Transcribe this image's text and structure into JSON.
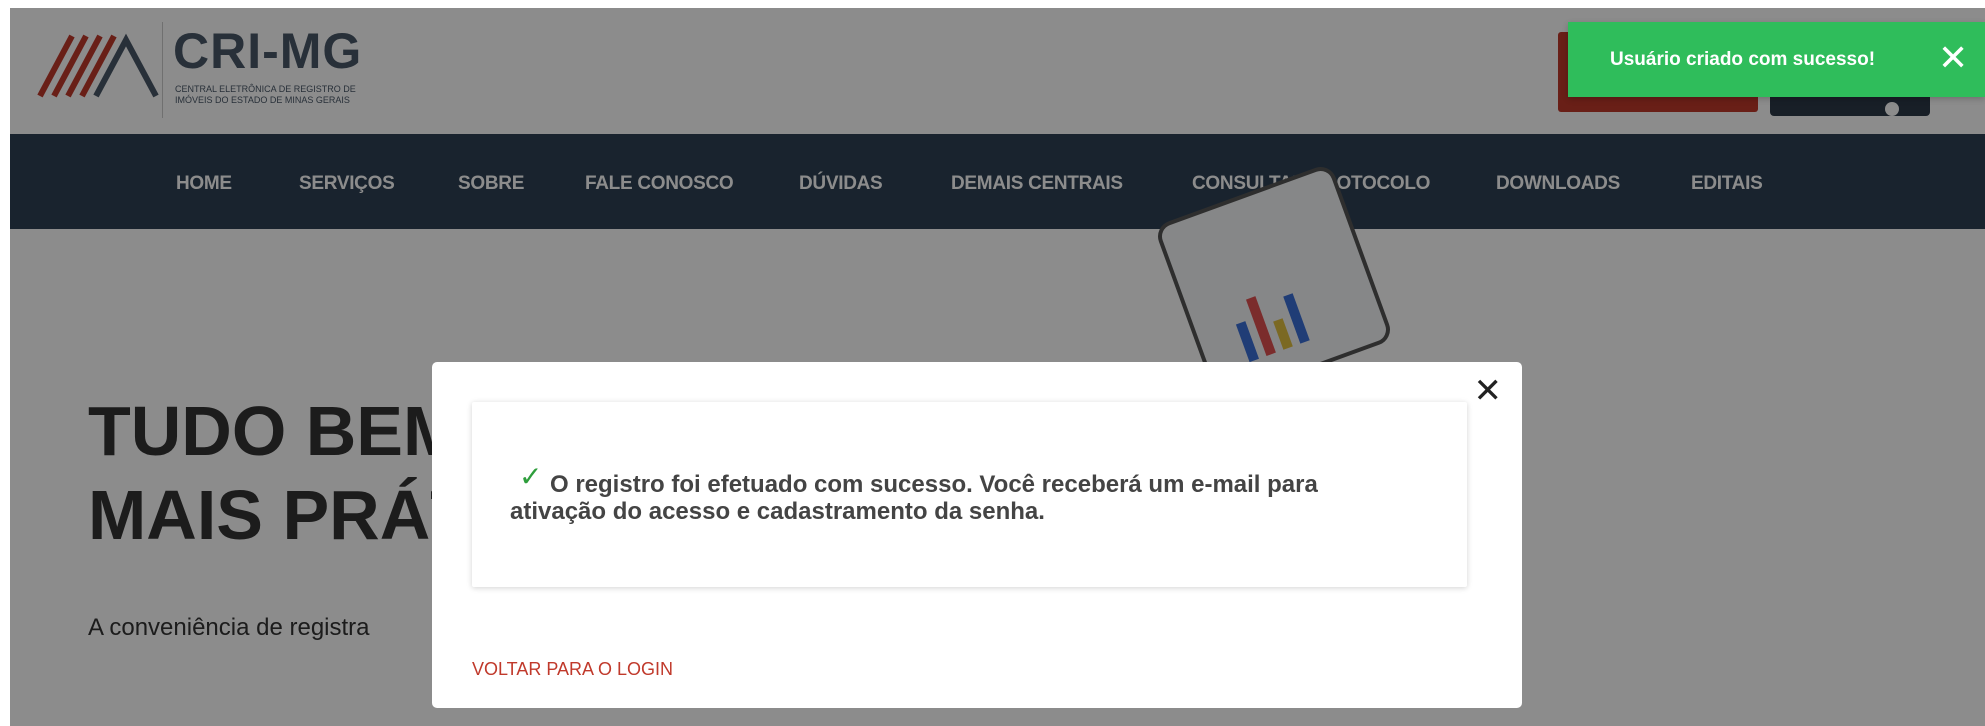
{
  "header": {
    "logo_title": "CRI-MG",
    "logo_subtitle": "CENTRAL ELETRÔNICA DE REGISTRO DE IMÓVEIS DO ESTADO DE MINAS GERAIS"
  },
  "nav": {
    "items": [
      {
        "label": "HOME"
      },
      {
        "label": "SERVIÇOS"
      },
      {
        "label": "SOBRE"
      },
      {
        "label": "FALE CONOSCO"
      },
      {
        "label": "DÚVIDAS"
      },
      {
        "label": "DEMAIS CENTRAIS"
      },
      {
        "label": "CONSULTAR PROTOCOLO"
      },
      {
        "label": "DOWNLOADS"
      },
      {
        "label": "EDITAIS"
      }
    ]
  },
  "hero": {
    "title_line1": "TUDO BEM",
    "title_line2": "MAIS PRÁT",
    "subtitle": "A conveniência de registra"
  },
  "modal": {
    "message": "O registro foi efetuado com sucesso. Você receberá um e-mail para ativação do acesso e cadastramento da senha.",
    "link_label": "VOLTAR PARA O LOGIN",
    "close_icon": "close-icon",
    "check_icon": "checkmark-icon"
  },
  "toast": {
    "message": "Usuário criado com sucesso!",
    "close_icon": "close-icon"
  },
  "colors": {
    "nav_background": "#2e4154",
    "toast_success": "#2fbd5b",
    "link_red": "#c0392b",
    "check_green": "#2e9e3c"
  }
}
